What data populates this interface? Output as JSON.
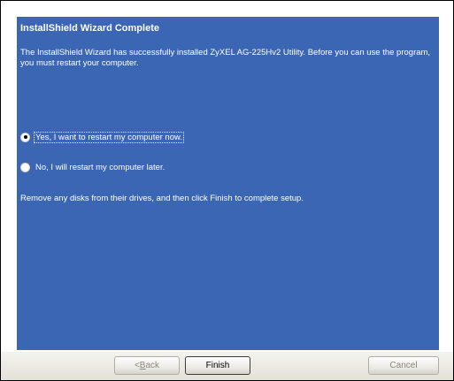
{
  "dialog": {
    "title": "InstallShield Wizard Complete",
    "message": "The InstallShield Wizard has successfully installed ZyXEL AG-225Hv2 Utility.  Before you can use the program, you must restart your computer.",
    "options": [
      {
        "label": "Yes, I want to restart my computer now.",
        "selected": true
      },
      {
        "label": "No, I will restart my computer later.",
        "selected": false
      }
    ],
    "instruction": "Remove any disks from their drives, and then click Finish to complete setup."
  },
  "buttons": {
    "back_prefix": "< ",
    "back_mnemonic": "B",
    "back_rest": "ack",
    "finish": "Finish",
    "cancel": "Cancel"
  },
  "colors": {
    "panel": "#3a66b4",
    "text": "#ffffff"
  }
}
